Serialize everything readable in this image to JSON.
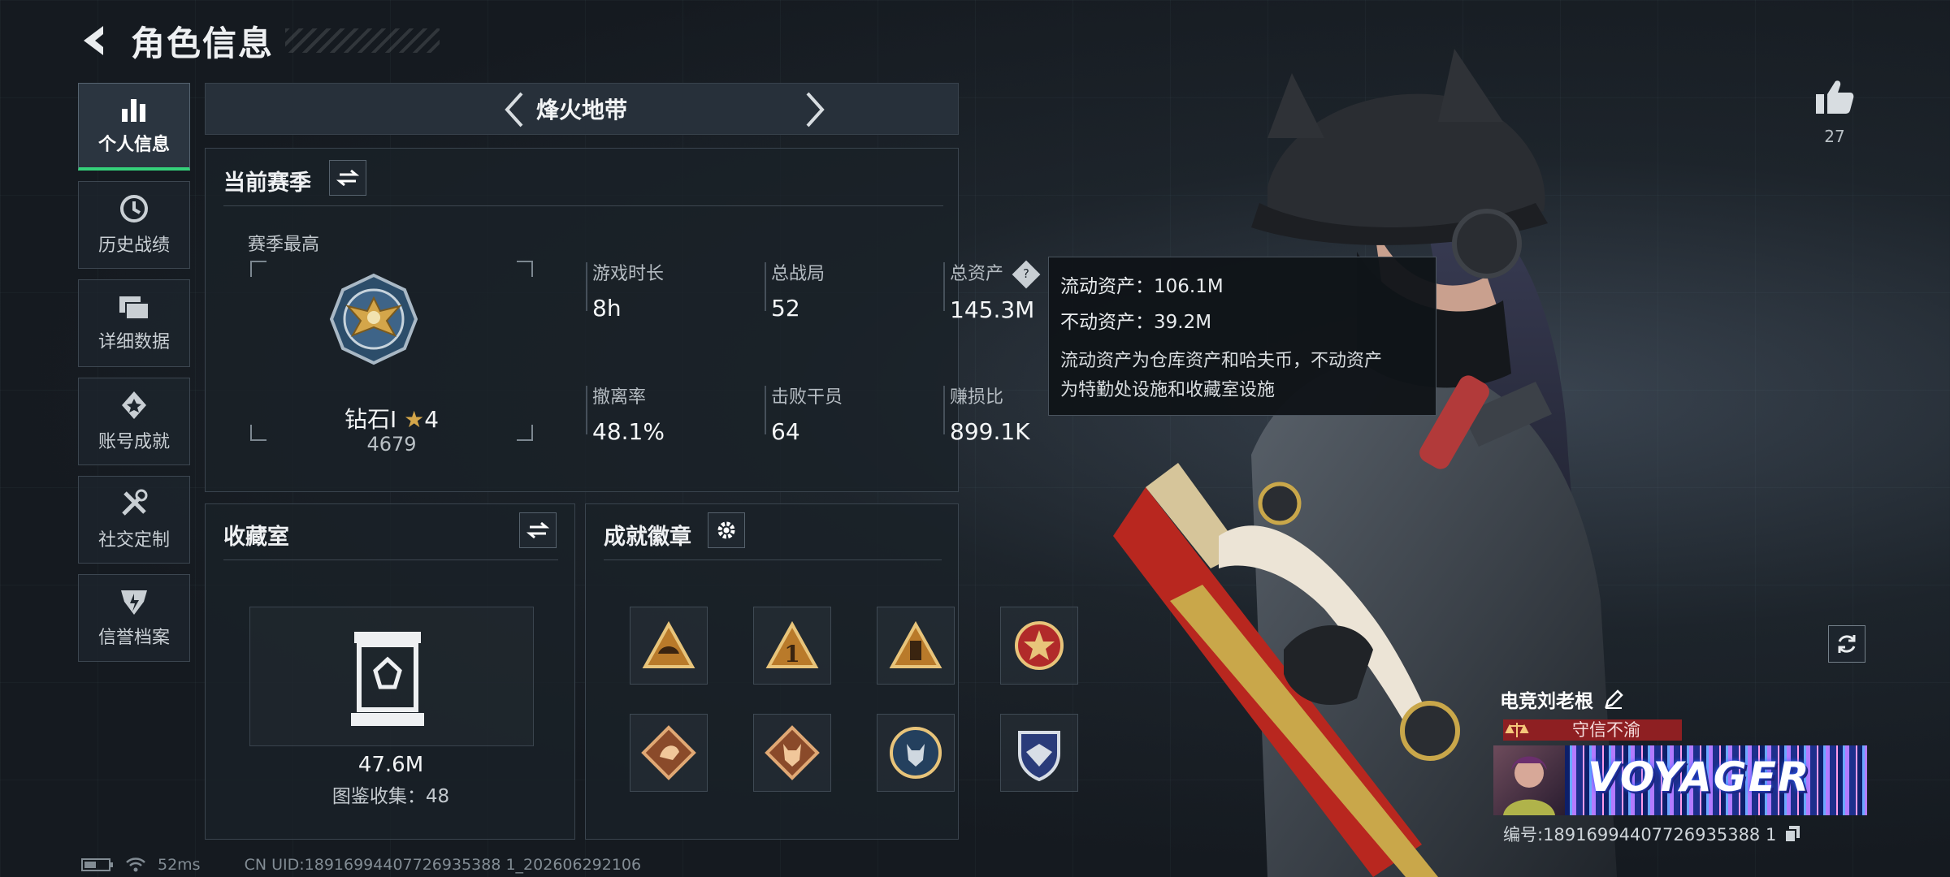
{
  "header": {
    "title": "角色信息"
  },
  "sidebar": {
    "items": [
      {
        "label": "个人信息",
        "icon": "bar-chart-icon",
        "active": true
      },
      {
        "label": "历史战绩",
        "icon": "history-clock-icon"
      },
      {
        "label": "详细数据",
        "icon": "folders-icon"
      },
      {
        "label": "账号成就",
        "icon": "achievement-icon"
      },
      {
        "label": "社交定制",
        "icon": "tools-icon"
      },
      {
        "label": "信誉档案",
        "icon": "shield-emblem-icon"
      }
    ]
  },
  "mode": {
    "title": "烽火地带"
  },
  "season": {
    "title": "当前赛季",
    "best_label": "赛季最高",
    "rank_name": "钻石I",
    "rank_stars": "4",
    "rank_score": "4679",
    "stats": [
      {
        "label": "游戏时长",
        "value": "8h"
      },
      {
        "label": "总战局",
        "value": "52"
      },
      {
        "label": "总资产",
        "value": "145.3M"
      },
      {
        "label": "撤离率",
        "value": "48.1%"
      },
      {
        "label": "击败干员",
        "value": "64"
      },
      {
        "label": "赚损比",
        "value": "899.1K"
      }
    ]
  },
  "tooltip": {
    "liquid": "流动资产：106.1M",
    "fixed": "不动资产：39.2M",
    "desc_line1": "流动资产为仓库资产和哈夫币，不动资产",
    "desc_line2": "为特勤处设施和收藏室设施"
  },
  "collection": {
    "title": "收藏室",
    "value": "47.6M",
    "count_label": "图鉴收集：48"
  },
  "achievements": {
    "title": "成就徽章",
    "badges": [
      "hat-triangle-badge",
      "number-one-triangle-badge",
      "tower-triangle-badge",
      "star-medal-badge",
      "dragon-diamond-badge",
      "wolf-diamond-badge",
      "wolf-round-badge",
      "eagle-shield-badge"
    ]
  },
  "status": {
    "ping": "52ms",
    "uid": "CN UID:18916994407726935388 1_202606292106"
  },
  "profile": {
    "likes": "27",
    "name": "电竞刘老根",
    "trust": "守信不渝",
    "banner_text": "VOYAGER",
    "id_label": "编号:18916994407726935388 1"
  },
  "colors": {
    "accent_green": "#35d17a",
    "trust_red": "#8e1f22",
    "gold": "#d4a64a"
  }
}
